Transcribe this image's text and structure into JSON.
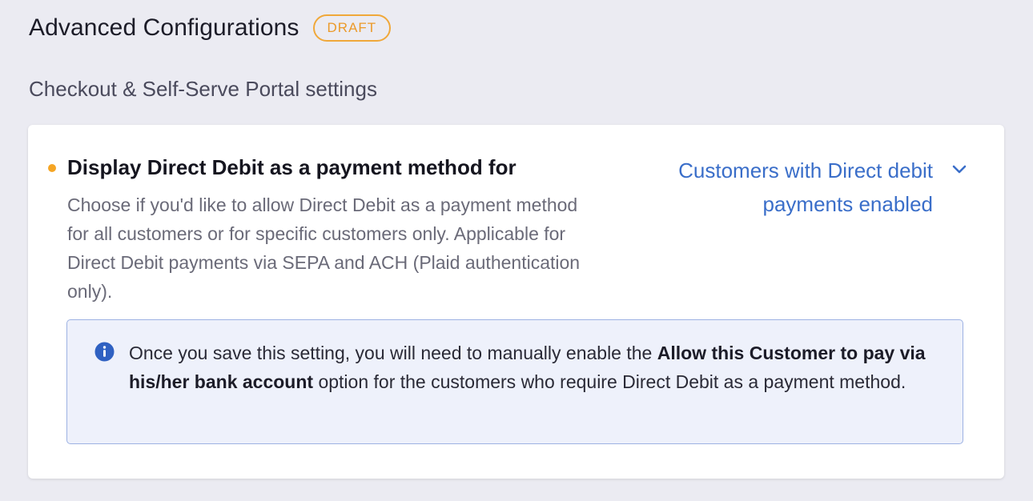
{
  "header": {
    "title": "Advanced Configurations",
    "badge": "DRAFT"
  },
  "section": {
    "title": "Checkout & Self-Serve Portal settings"
  },
  "setting": {
    "title": "Display Direct Debit as a payment method for",
    "description": "Choose if you'd like to allow Direct Debit as a payment method for all customers or for specific customers only. Applicable for Direct Debit payments via SEPA and ACH (Plaid authentication only).",
    "dropdown": {
      "selected_value": "Customers with Direct debit payments enabled",
      "icon": "chevron-down-icon"
    },
    "status_dot_color": "#f5a524"
  },
  "info": {
    "icon": "info-icon",
    "text_before": "Once you save this setting, you will need to manually enable the ",
    "text_bold": "Allow this Customer to pay via his/her bank account",
    "text_after": " option for the customers who require Direct Debit as a payment method."
  },
  "colors": {
    "background": "#ebebf2",
    "accent_link": "#3a6ec9",
    "draft_orange": "#eb9a2a",
    "info_border": "#9db2e3",
    "info_background": "#eef1fb"
  }
}
